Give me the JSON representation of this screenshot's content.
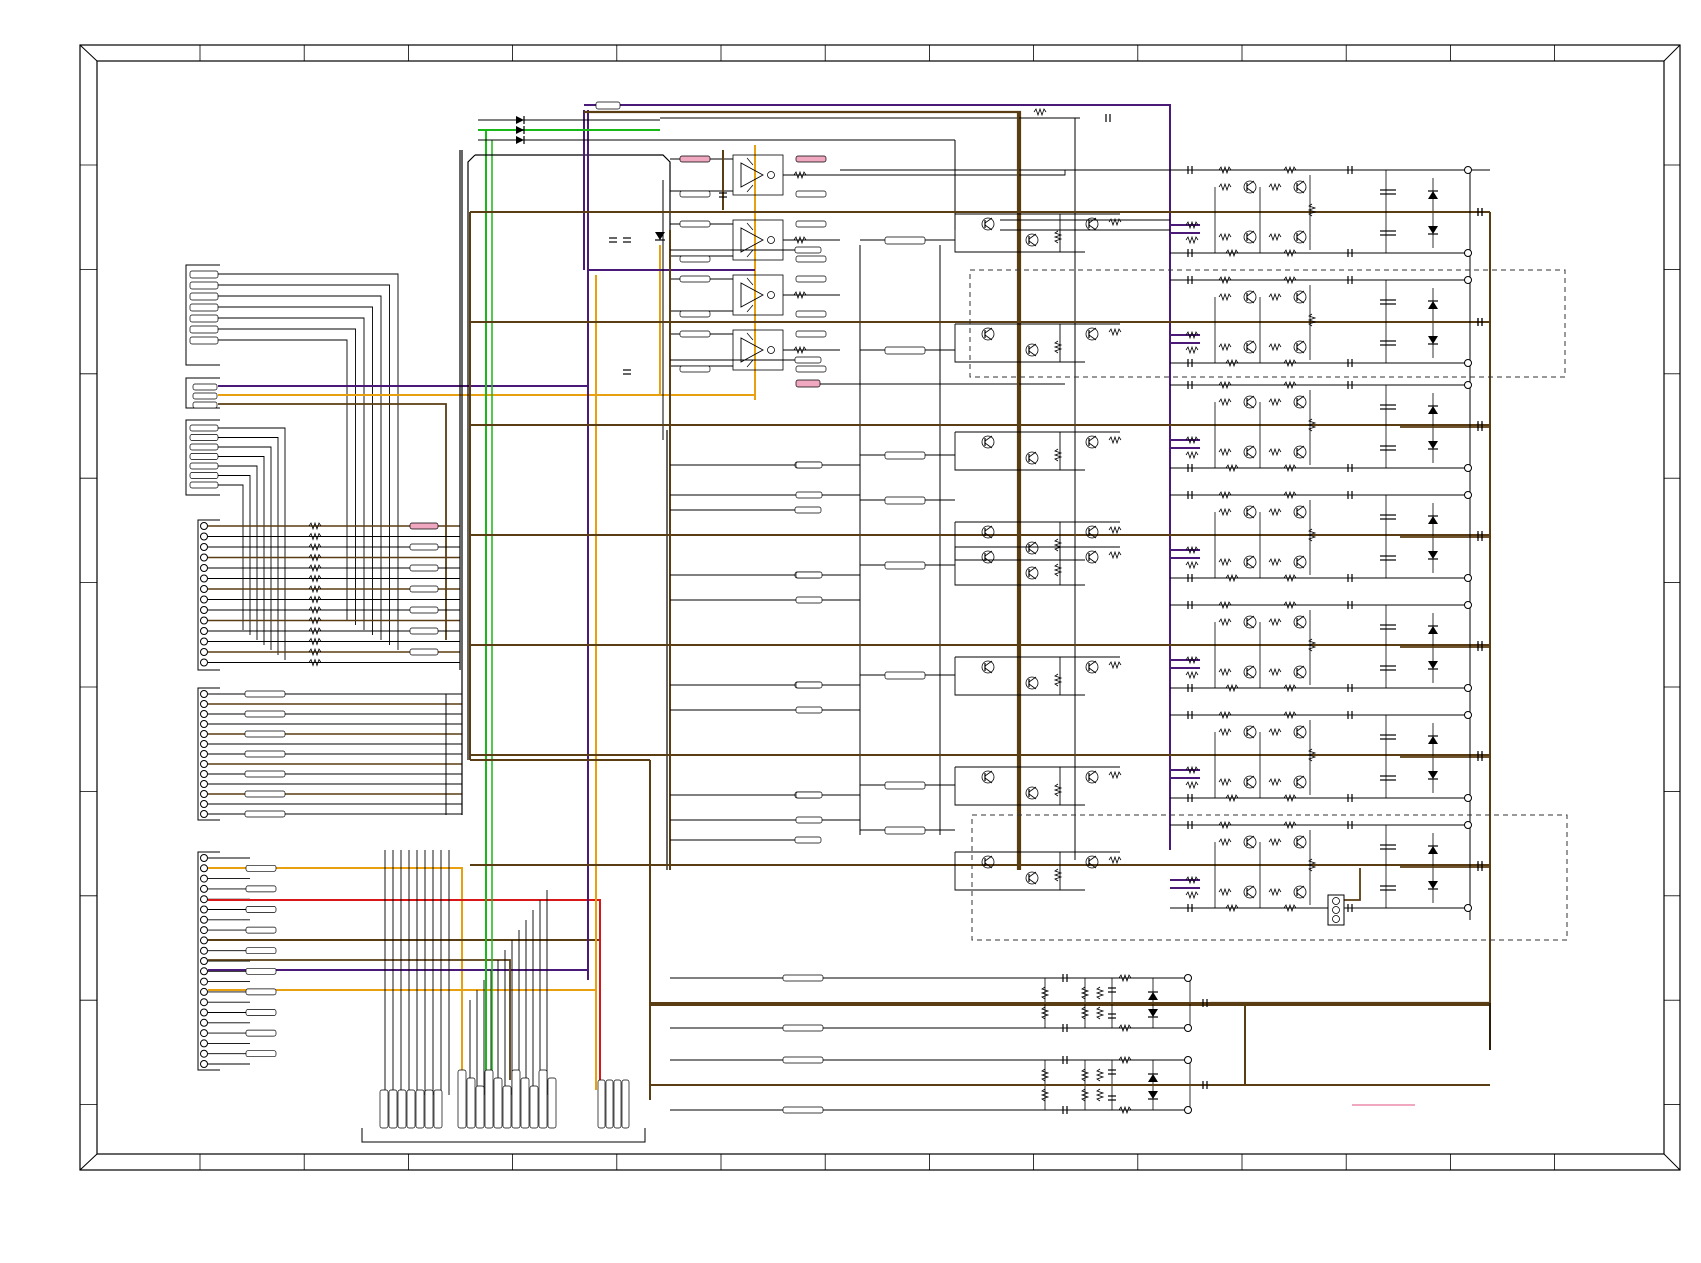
{
  "sheet": {
    "title_block": "",
    "text_labels": []
  },
  "colors": {
    "frame": "#000000",
    "wire": "#000000",
    "brown": "#5a3d12",
    "purple": "#4b1a78",
    "orange": "#e8a010",
    "green": "#18b818",
    "red": "#d81818",
    "gray": "#9a9a9a",
    "pink": "#f0a8c0",
    "dashed": "#333333"
  },
  "icons": {
    "resistor": "resistor-icon",
    "capacitor": "capacitor-icon",
    "diode": "diode-icon",
    "transistor": "transistor-icon",
    "op_amp": "op-amp-icon",
    "connector_pin": "connector-pin-icon",
    "terminal": "terminal-icon"
  },
  "counts": {
    "output_channels": 12,
    "opamps": 4,
    "left_connectors": 5,
    "bottom_terminals": 20
  }
}
